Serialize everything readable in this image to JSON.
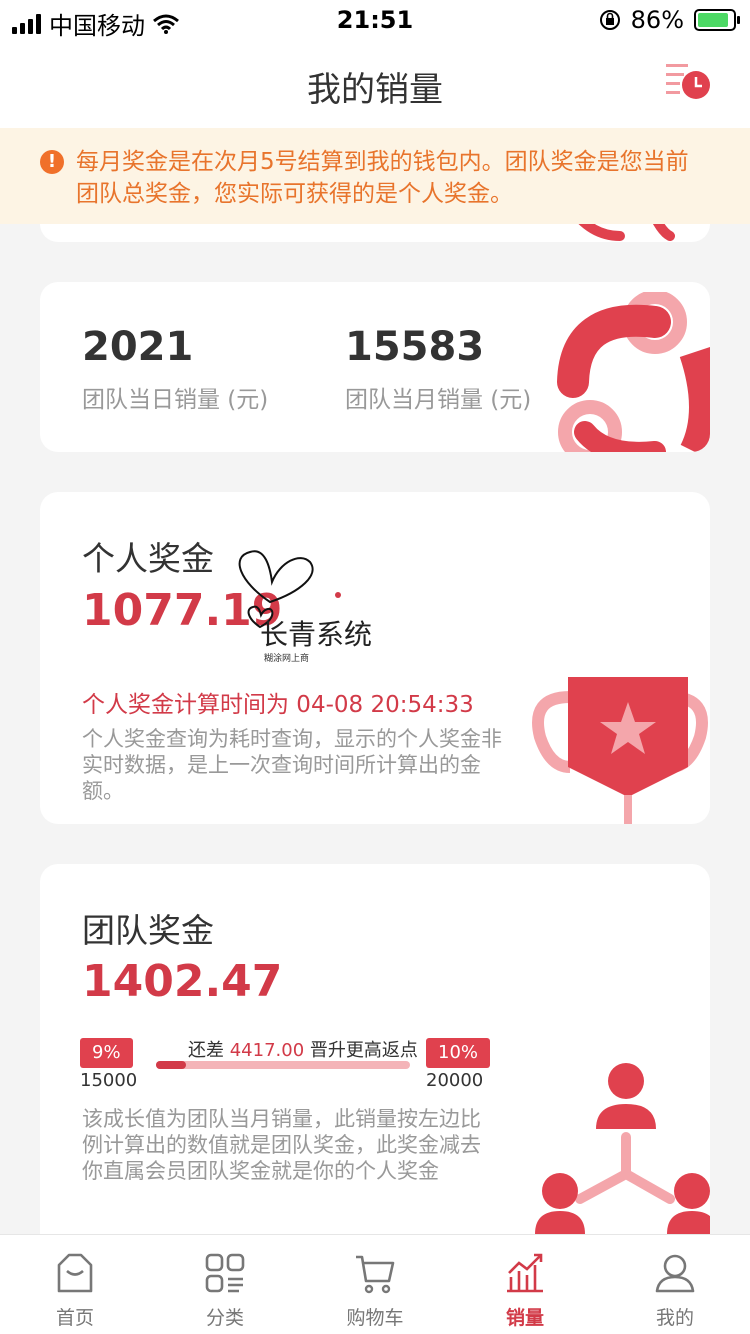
{
  "status_bar": {
    "carrier": "中国移动",
    "time": "21:51",
    "battery": "86%"
  },
  "header": {
    "title": "我的销量",
    "history_icon": "history-clock-icon"
  },
  "notice": {
    "text": "每月奖金是在次月5号结算到我的钱包内。团队奖金是您当前团队总奖金，您实际可获得的是个人奖金。",
    "icon": "warning-icon"
  },
  "sales": {
    "daily_value": "2021",
    "daily_label": "团队当日销量 (元)",
    "monthly_value": "15583",
    "monthly_label": "团队当月销量 (元)"
  },
  "personal_bonus": {
    "title": "个人奖金",
    "amount": "1077.19",
    "calc_time_label": "个人奖金计算时间为 04-08 20:54:33",
    "description": "个人奖金查询为耗时查询，显示的个人奖金非实时数据，是上一次查询时间所计算出的金额。"
  },
  "watermark": {
    "text": "长青系统",
    "sub": "糊涂网上商"
  },
  "team_bonus": {
    "title": "团队奖金",
    "amount": "1402.47",
    "current_pct": "9%",
    "current_threshold": "15000",
    "next_pct": "10%",
    "next_threshold": "20000",
    "gap_prefix": "还差",
    "gap_amount": "4417.00",
    "gap_suffix": "晋升更高返点",
    "progress_fraction": 0.12,
    "description": "该成长值为团队当月销量，此销量按左边比例计算出的数值就是团队奖金，此奖金减去你直属会员团队奖金就是你的个人奖金"
  },
  "tabbar": {
    "items": [
      {
        "label": "首页",
        "icon": "home-icon"
      },
      {
        "label": "分类",
        "icon": "category-icon"
      },
      {
        "label": "购物车",
        "icon": "cart-icon"
      },
      {
        "label": "销量",
        "icon": "sales-chart-icon"
      },
      {
        "label": "我的",
        "icon": "profile-icon"
      }
    ],
    "active_index": 3
  },
  "colors": {
    "accent": "#d23a48",
    "notice_text": "#e8742c",
    "notice_bg": "#fdf4e4"
  }
}
